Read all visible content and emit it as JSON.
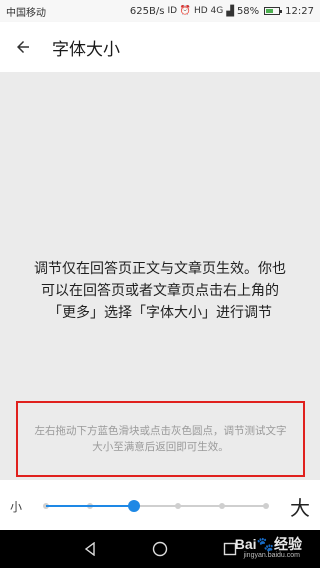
{
  "status_bar": {
    "carrier": "中国移动",
    "speed": "625B/s",
    "indicators": "ID ⏰ HD 4G",
    "battery": "58%",
    "battery_level": 58,
    "time": "12:27"
  },
  "header": {
    "title": "字体大小",
    "back_icon": "arrow-left-icon"
  },
  "content": {
    "preview_text": "调节仅在回答页正文与文章页生效。你也可以在回答页或者文章页点击右上角的「更多」选择「字体大小」进行调节",
    "hint_text": "左右拖动下方蓝色滑块或点击灰色圆点，调节测试文字大小至满意后返回即可生效。"
  },
  "font_slider": {
    "small_label": "小",
    "large_label": "大",
    "steps": 6,
    "current_step": 2,
    "accent_color": "#1e88e5",
    "inactive_color": "#cfcfcf"
  },
  "nav_bar": {
    "back_icon": "triangle-back-icon",
    "home_icon": "circle-home-icon",
    "recents_icon": "square-recents-icon"
  },
  "watermark": {
    "brand": "Bai",
    "brand_suffix": "经验",
    "url": "jingyan.baidu.com"
  },
  "colors": {
    "highlight_border": "#e0201d",
    "background": "#ebebeb"
  }
}
